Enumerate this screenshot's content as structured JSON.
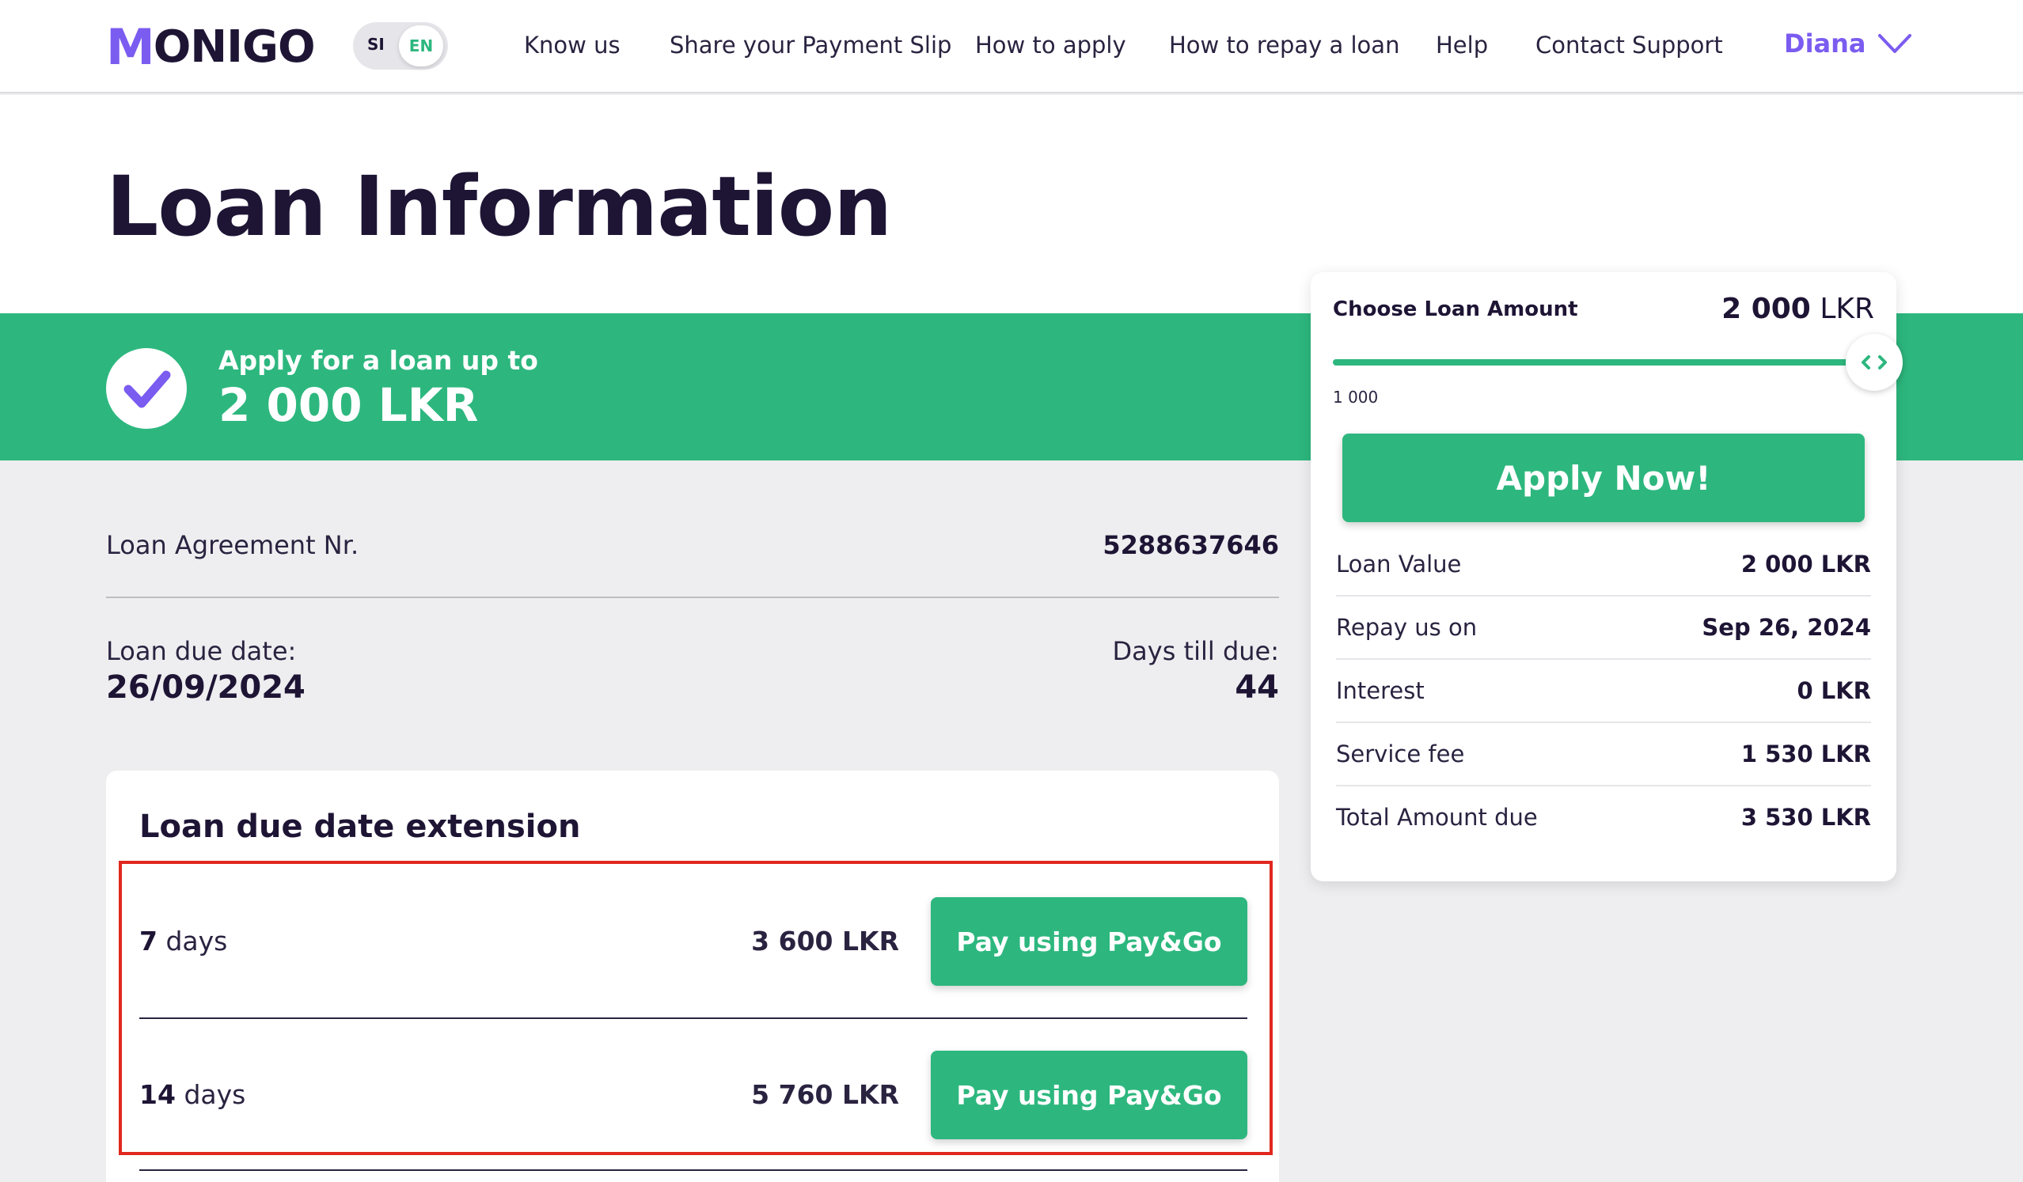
{
  "header": {
    "logo_m": "M",
    "logo_rest": "ONIGO",
    "lang_si": "SI",
    "lang_en": "EN",
    "nav": [
      "Know us",
      "Share your Payment Slip",
      "How to apply",
      "How to repay a loan",
      "Help",
      "Contact Support"
    ],
    "user_name": "Diana"
  },
  "page_title": "Loan Information",
  "banner": {
    "subtitle": "Apply for a loan up to",
    "amount": "2 000 LKR"
  },
  "loan": {
    "agreement_label": "Loan Agreement Nr.",
    "agreement_value": "5288637646",
    "due_label": "Loan due date:",
    "due_value": "26/09/2024",
    "days_label": "Days till due:",
    "days_value": "44"
  },
  "extension": {
    "title": "Loan due date extension",
    "options": [
      {
        "days": "7",
        "unit": "days",
        "price": "3 600 LKR",
        "button": "Pay using Pay&Go"
      },
      {
        "days": "14",
        "unit": "days",
        "price": "5 760 LKR",
        "button": "Pay using Pay&Go"
      }
    ]
  },
  "calculator": {
    "label": "Choose Loan Amount",
    "amount_number": "2 000",
    "amount_unit": "LKR",
    "slider_min": "1 000",
    "slider_level": 1.0,
    "apply_button": "Apply Now!",
    "summary": [
      {
        "label": "Loan Value",
        "value": "2 000 LKR"
      },
      {
        "label": "Repay us on",
        "value": "Sep 26, 2024"
      },
      {
        "label": "Interest",
        "value": "0 LKR"
      },
      {
        "label": "Service fee",
        "value": "1 530 LKR"
      },
      {
        "label": "Total Amount due",
        "value": "3 530 LKR"
      }
    ]
  },
  "colors": {
    "brand_green": "#2db77e",
    "brand_purple": "#7b5cf0",
    "highlight_red": "#e0281e"
  }
}
